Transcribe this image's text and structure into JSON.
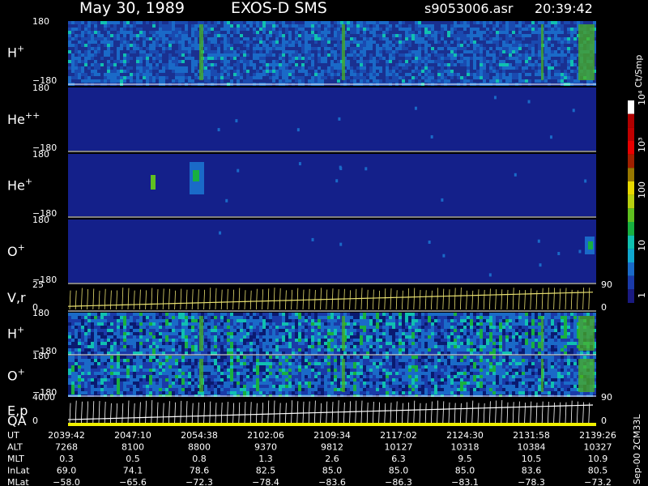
{
  "header": {
    "date": "May 30, 1989",
    "instrument": "EXOS-D SMS",
    "file": "s9053006.asr",
    "time": "20:39:42"
  },
  "colorbar": {
    "unit": "Ct/Smp",
    "ticks": [
      "1",
      "10",
      "100",
      "10³",
      "10⁴"
    ],
    "colors": [
      "#1a1a80",
      "#1a3aa8",
      "#1a6ac8",
      "#10a8d0",
      "#10c0b0",
      "#18b040",
      "#60c020",
      "#b8d010",
      "#e8d800",
      "#987800",
      "#a02000",
      "#e80000",
      "#c00000",
      "#b00000",
      "#ffffff"
    ]
  },
  "chart_data": [
    {
      "type": "heatmap",
      "panel": "H+",
      "label": "H",
      "sup": "+",
      "ylim": [
        -180,
        180
      ],
      "yticks": [
        "180",
        "−180"
      ],
      "level": "high"
    },
    {
      "type": "heatmap",
      "panel": "He++",
      "label": "He",
      "sup": "++",
      "ylim": [
        -180,
        180
      ],
      "yticks": [
        "180",
        "−180"
      ],
      "level": "low"
    },
    {
      "type": "heatmap",
      "panel": "He+",
      "label": "He",
      "sup": "+",
      "ylim": [
        -180,
        180
      ],
      "yticks": [
        "180",
        "−180"
      ],
      "level": "low"
    },
    {
      "type": "heatmap",
      "panel": "O+",
      "label": "O",
      "sup": "+",
      "ylim": [
        -180,
        180
      ],
      "yticks": [
        "180",
        "−180"
      ],
      "level": "low"
    },
    {
      "type": "line",
      "panel": "V,r",
      "label": "V,r",
      "ylim": [
        0,
        25
      ],
      "yticks": [
        "25",
        "0"
      ],
      "right_ticks": [
        "90",
        "0"
      ]
    },
    {
      "type": "heatmap",
      "panel": "H+ (2)",
      "label": "H",
      "sup": "+",
      "ylim": [
        -180,
        180
      ],
      "yticks": [
        "180",
        "−180"
      ],
      "level": "striped"
    },
    {
      "type": "heatmap",
      "panel": "O+ (2)",
      "label": "O",
      "sup": "+",
      "ylim": [
        -180,
        180
      ],
      "yticks": [
        "180",
        "−180"
      ],
      "level": "striped"
    },
    {
      "type": "line",
      "panel": "E,p",
      "label": "E,p",
      "label2": "QA",
      "ylim": [
        0,
        4000
      ],
      "yticks": [
        "4000",
        "0"
      ],
      "right_ticks": [
        "90",
        "0"
      ]
    },
    {
      "type": "table",
      "rows": [
        {
          "name": "UT",
          "values": [
            "2039:42",
            "2047:10",
            "2054:38",
            "2102:06",
            "2109:34",
            "2117:02",
            "2124:30",
            "2131:58",
            "2139:26"
          ]
        },
        {
          "name": "ALT",
          "values": [
            "7268",
            "8100",
            "8800",
            "9370",
            "9812",
            "10127",
            "10318",
            "10384",
            "10327"
          ]
        },
        {
          "name": "MLT",
          "values": [
            "0.3",
            "0.5",
            "0.8",
            "1.3",
            "2.6",
            "6.3",
            "9.5",
            "10.5",
            "10.9"
          ]
        },
        {
          "name": "InLat",
          "values": [
            "69.0",
            "74.1",
            "78.6",
            "82.5",
            "85.0",
            "85.0",
            "85.0",
            "83.6",
            "80.5"
          ]
        },
        {
          "name": "MLat",
          "values": [
            "−58.0",
            "−65.6",
            "−72.3",
            "−78.4",
            "−83.6",
            "−86.3",
            "−83.1",
            "−78.3",
            "−73.2"
          ]
        }
      ]
    }
  ],
  "footer_note": "Sep-00 2CM33L"
}
